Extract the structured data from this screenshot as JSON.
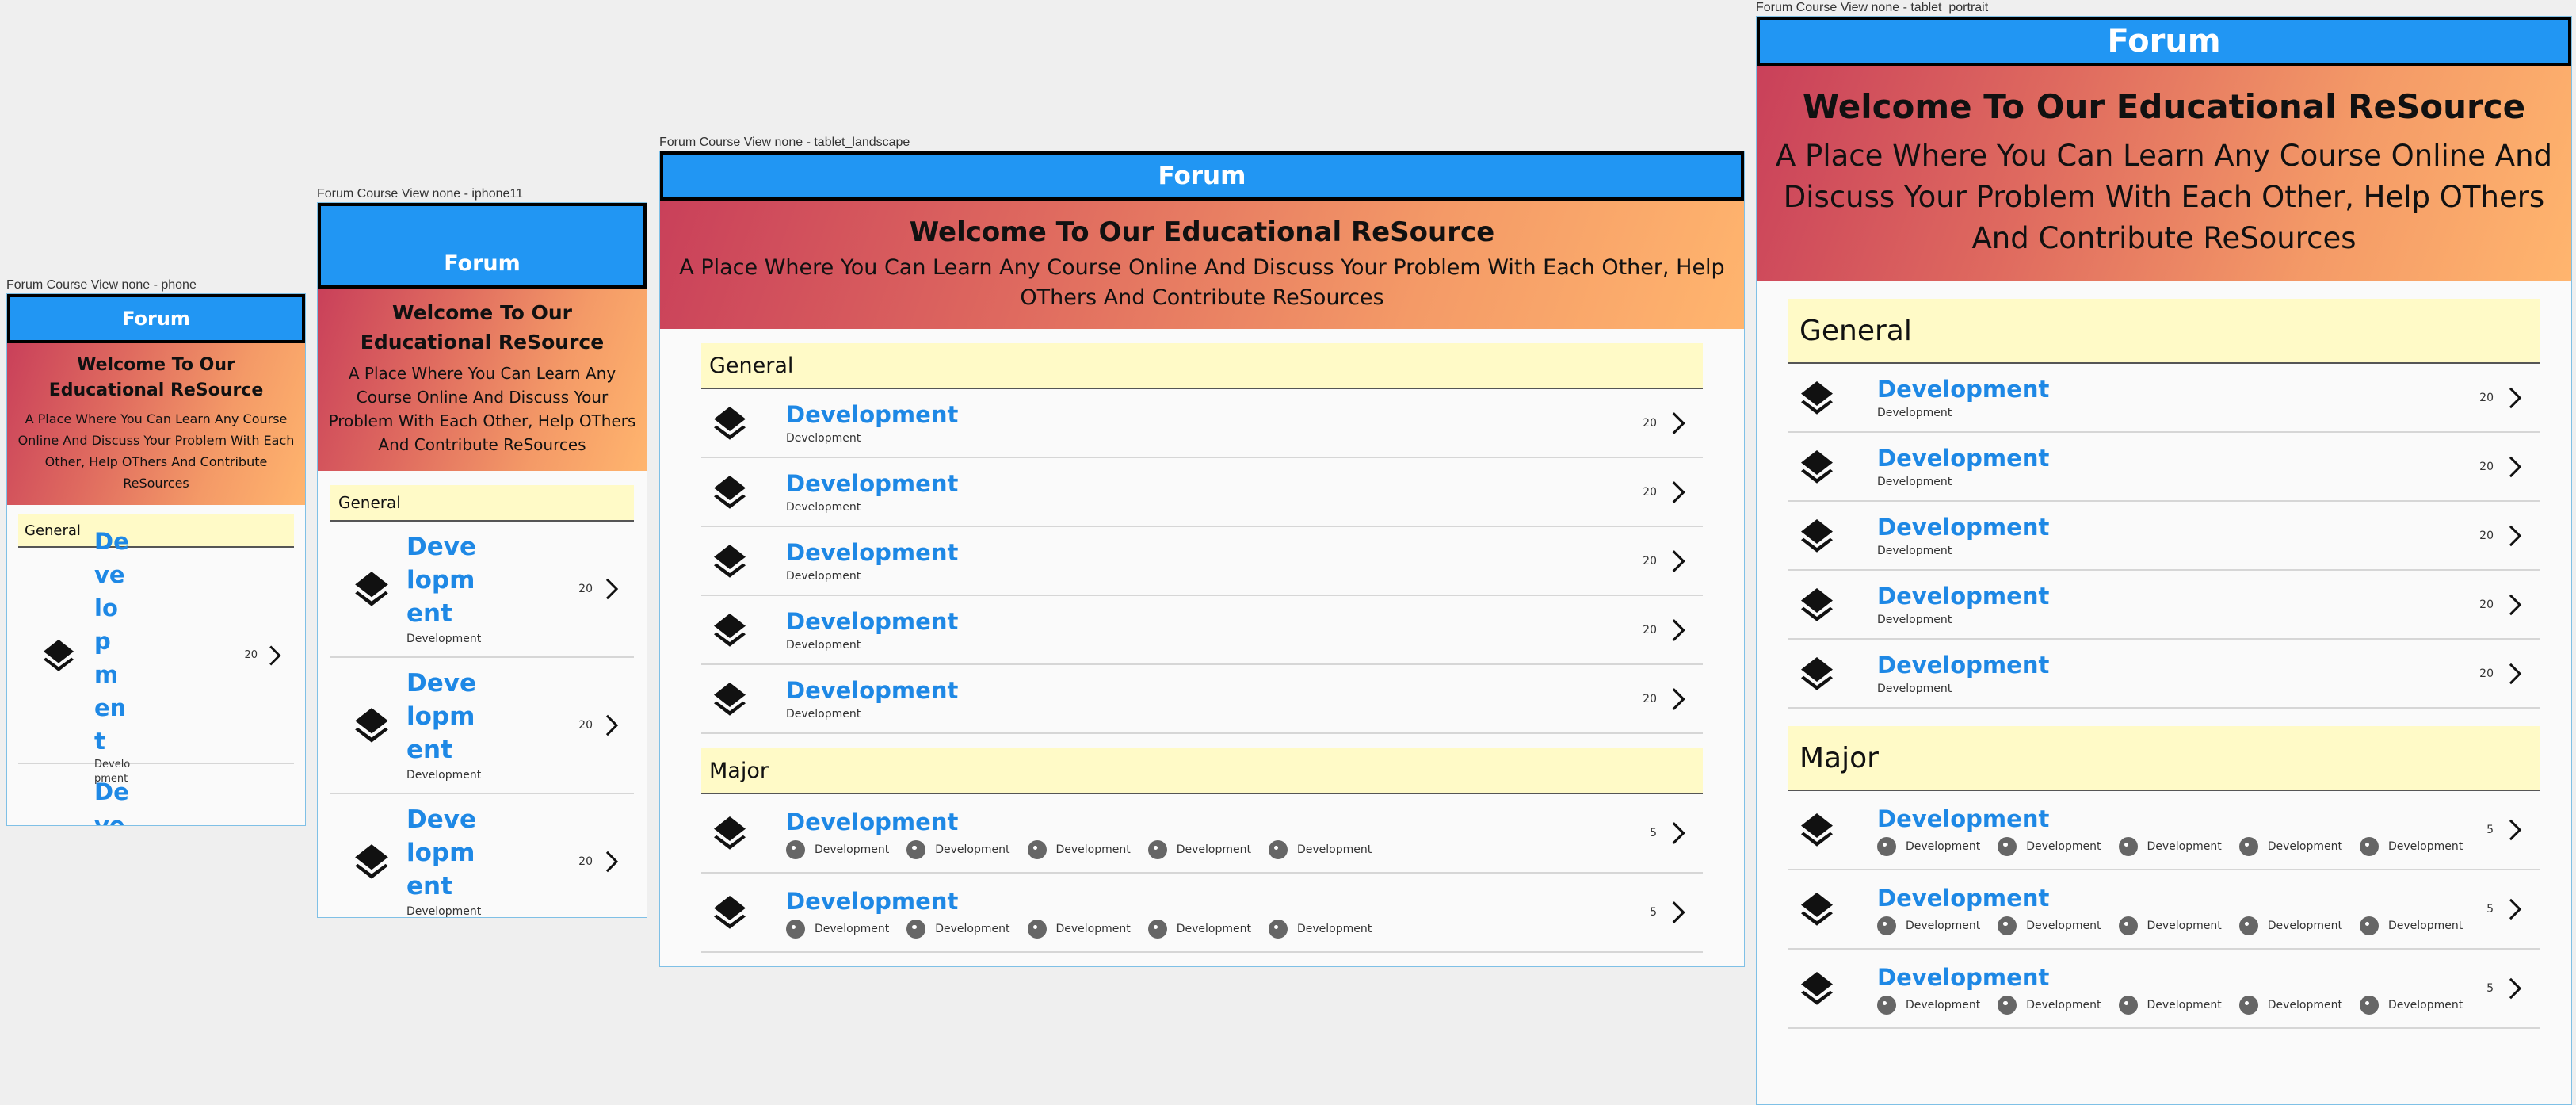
{
  "app": {
    "title": "Forum",
    "hero_title": "Welcome To Our Educational ReSource",
    "hero_subtitle": "A Place Where You Can Learn Any Course Online And Discuss Your Problem With Each Other, Help OThers And Contribute ReSources"
  },
  "frames": {
    "phone": "Forum Course View none - phone",
    "iphone11": "Forum Course View none - iphone11",
    "tablet_landscape": "Forum Course View none - tablet_landscape",
    "tablet_portrait": "Forum Course View none - tablet_portrait"
  },
  "sections": {
    "general": {
      "title": "General",
      "item_title": "Development",
      "item_subtitle": "Development",
      "item_count": "20"
    },
    "major": {
      "title": "Major",
      "item_title": "Development",
      "item_count": "5",
      "chips": [
        "Development",
        "Development",
        "Development",
        "Development",
        "Development"
      ]
    }
  },
  "icons": {
    "item_icon": "layers-icon",
    "row_action": "chevron-right-icon",
    "chip_icon": "cookie-icon"
  },
  "colors": {
    "appbar": "#2196f3",
    "title_link": "#1e88e5",
    "section_header": "#fffac7",
    "gradient_start": "#c9405a",
    "gradient_end": "#ffb56e"
  }
}
